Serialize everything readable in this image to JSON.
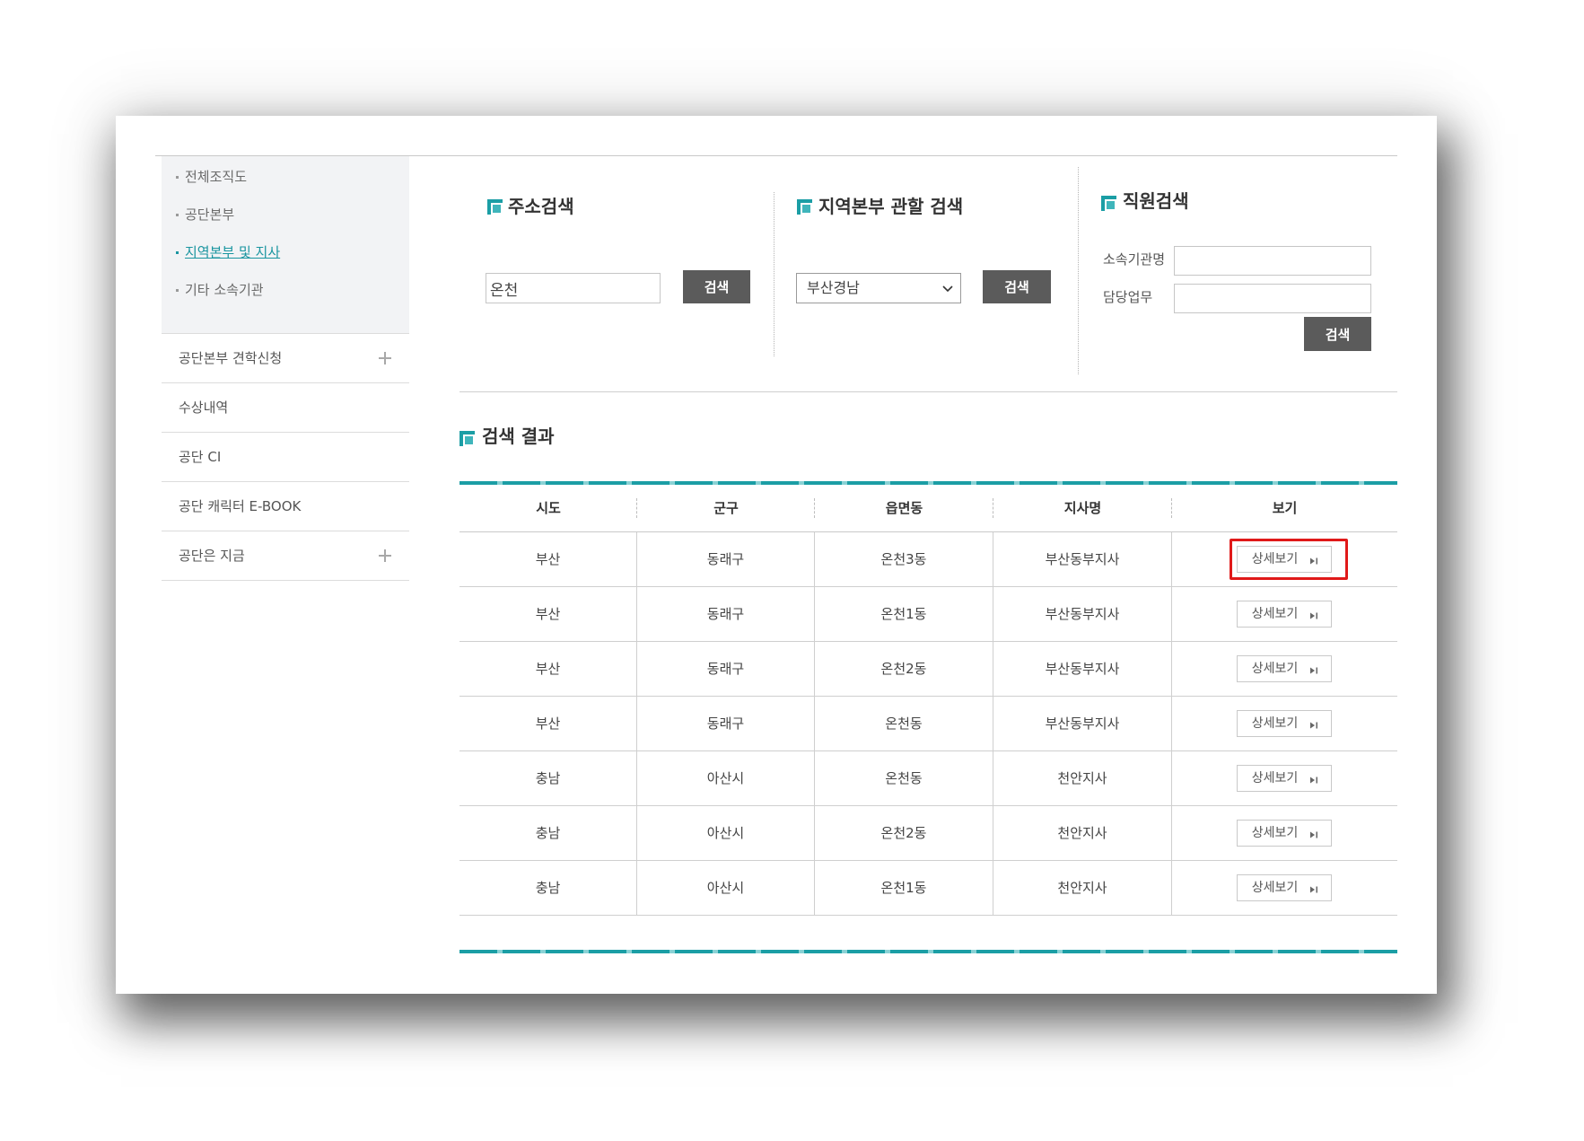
{
  "sidebar": {
    "submenu": [
      {
        "label": "전체조직도",
        "active": false
      },
      {
        "label": "공단본부",
        "active": false
      },
      {
        "label": "지역본부 및 지사",
        "active": true
      },
      {
        "label": "기타 소속기관",
        "active": false
      }
    ],
    "menu": [
      {
        "label": "공단본부 견학신청",
        "expandable": true
      },
      {
        "label": "수상내역",
        "expandable": false
      },
      {
        "label": "공단 CI",
        "expandable": false
      },
      {
        "label": "공단 캐릭터 E-BOOK",
        "expandable": false
      },
      {
        "label": "공단은 지금",
        "expandable": true
      }
    ]
  },
  "address_search": {
    "title": "주소검색",
    "input_value": "온천",
    "button_label": "검색"
  },
  "region_search": {
    "title": "지역본부 관할 검색",
    "selected": "부산경남",
    "button_label": "검색"
  },
  "staff_search": {
    "title": "직원검색",
    "org_label": "소속기관명",
    "org_value": "",
    "duty_label": "담당업무",
    "duty_value": "",
    "button_label": "검색"
  },
  "results": {
    "title": "검색 결과",
    "columns": [
      "시도",
      "군구",
      "읍면동",
      "지사명",
      "보기"
    ],
    "detail_label": "상세보기",
    "rows": [
      {
        "province": "부산",
        "district": "동래구",
        "town": "온천3동",
        "branch": "부산동부지사",
        "highlighted": true
      },
      {
        "province": "부산",
        "district": "동래구",
        "town": "온천1동",
        "branch": "부산동부지사"
      },
      {
        "province": "부산",
        "district": "동래구",
        "town": "온천2동",
        "branch": "부산동부지사"
      },
      {
        "province": "부산",
        "district": "동래구",
        "town": "온천동",
        "branch": "부산동부지사"
      },
      {
        "province": "충남",
        "district": "아산시",
        "town": "온천동",
        "branch": "천안지사"
      },
      {
        "province": "충남",
        "district": "아산시",
        "town": "온천2동",
        "branch": "천안지사"
      },
      {
        "province": "충남",
        "district": "아산시",
        "town": "온천1동",
        "branch": "천안지사"
      }
    ]
  },
  "icons": {
    "section": "square-bullet-icon",
    "expand": "plus-icon",
    "dropdown": "chevron-down-icon",
    "detail": "arrow-next-icon"
  },
  "colors": {
    "accent": "#1b9ea5",
    "button": "#5b5b5b",
    "highlight": "#e01919",
    "active_link": "#1a95a0"
  }
}
